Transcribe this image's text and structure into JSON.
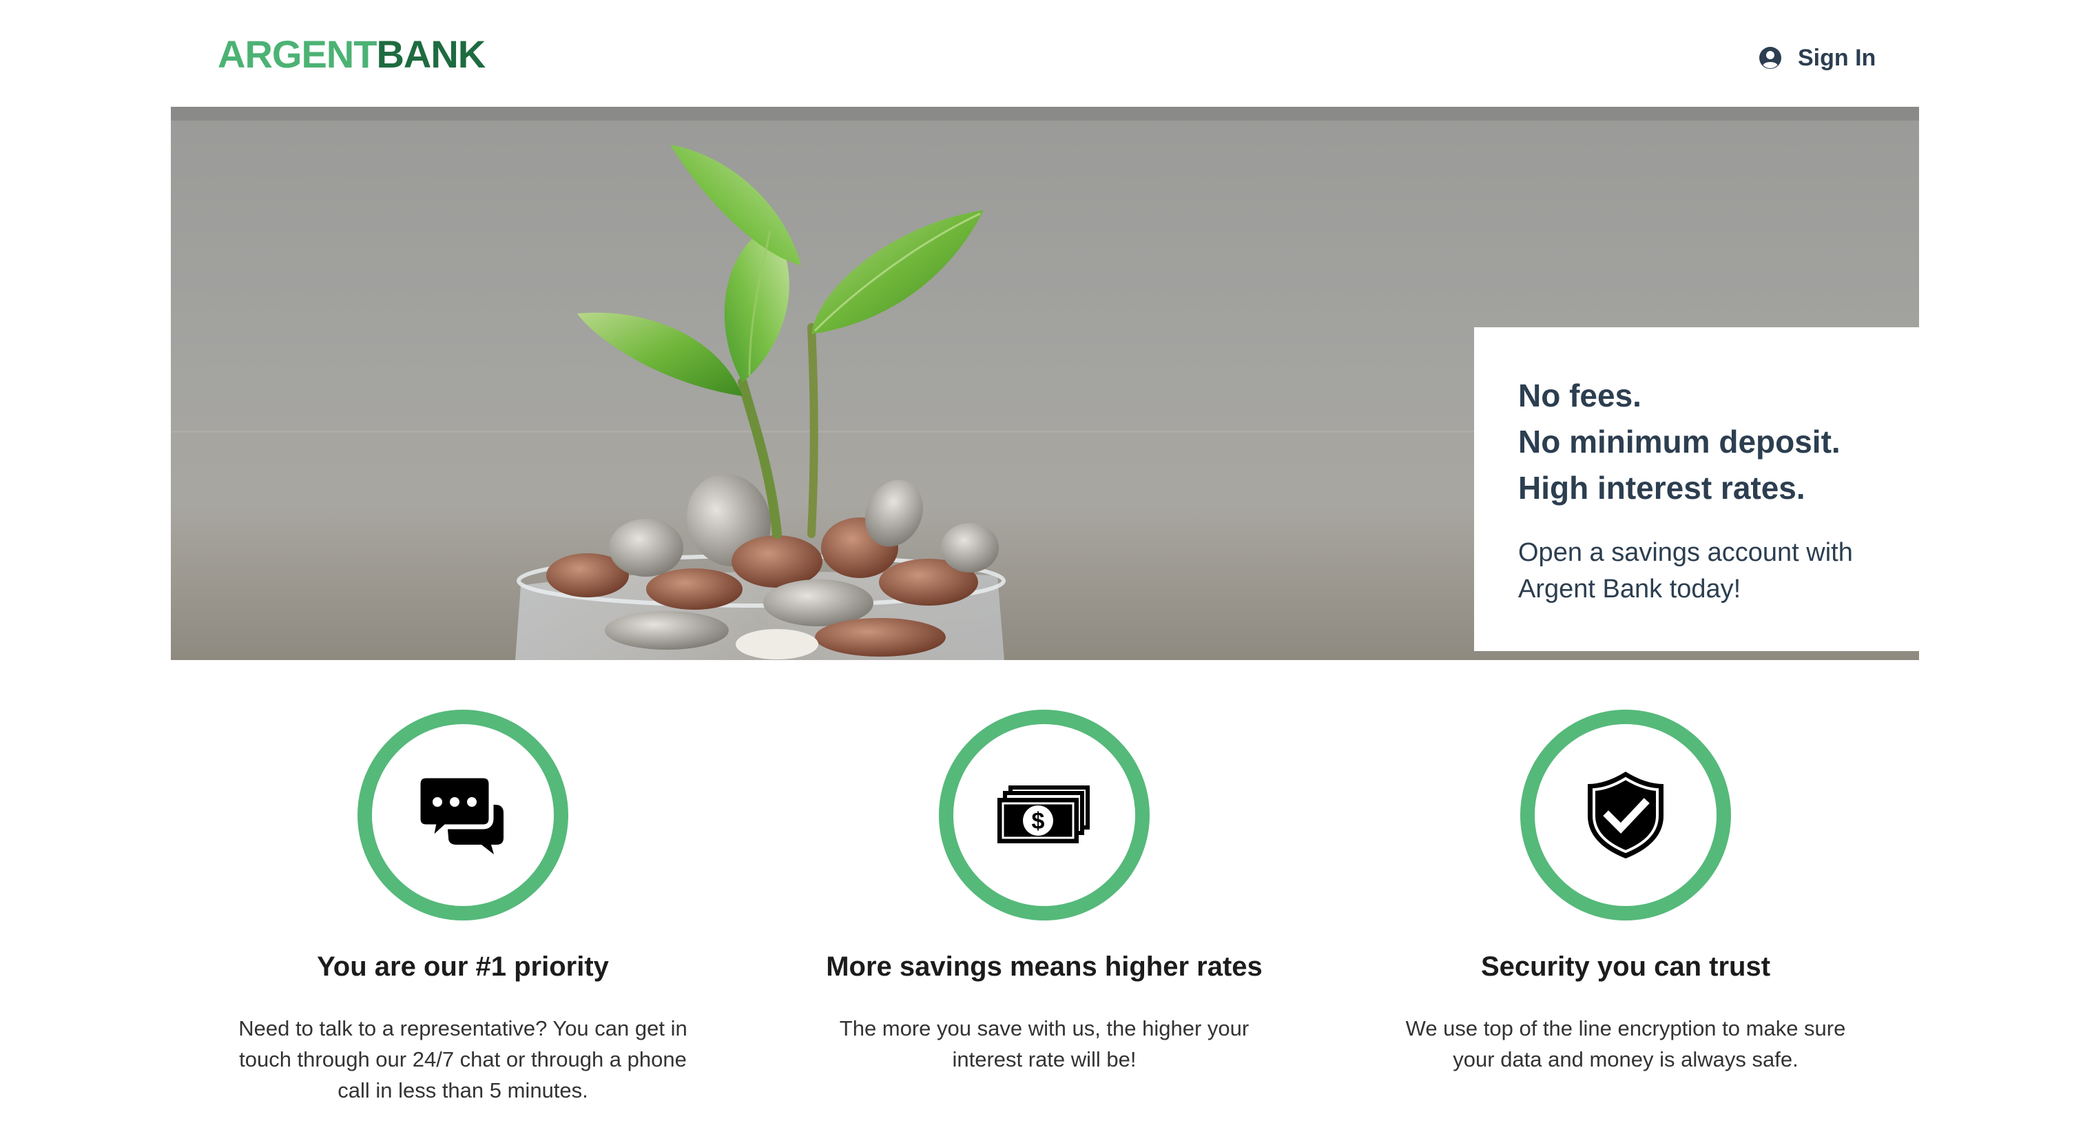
{
  "header": {
    "logo_part1": "ARGENT",
    "logo_part2": "BANK",
    "sign_in_label": "Sign In",
    "sign_in_icon": "user-circle-icon"
  },
  "hero": {
    "image_subject": "seedling growing from a glass jar of coins",
    "headline_lines": [
      "No fees.",
      "No minimum deposit.",
      "High interest rates."
    ],
    "body": "Open a savings account with Argent Bank today!"
  },
  "features": [
    {
      "icon": "chat-bubbles-icon",
      "title": "You are our #1 priority",
      "text": "Need to talk to a representative? You can get in touch through our 24/7 chat or through a phone call in less than 5 minutes."
    },
    {
      "icon": "money-bills-icon",
      "title": "More savings means higher rates",
      "text": "The more you save with us, the higher your interest rate will be!"
    },
    {
      "icon": "shield-check-icon",
      "title": "Security you can trust",
      "text": "We use top of the line encryption to make sure your data and money is always safe."
    }
  ],
  "colors": {
    "brand_green": "#4cb274",
    "brand_dark_green": "#1e6b40",
    "ring_green": "#55b97a",
    "text_navy": "#2c3e50"
  }
}
